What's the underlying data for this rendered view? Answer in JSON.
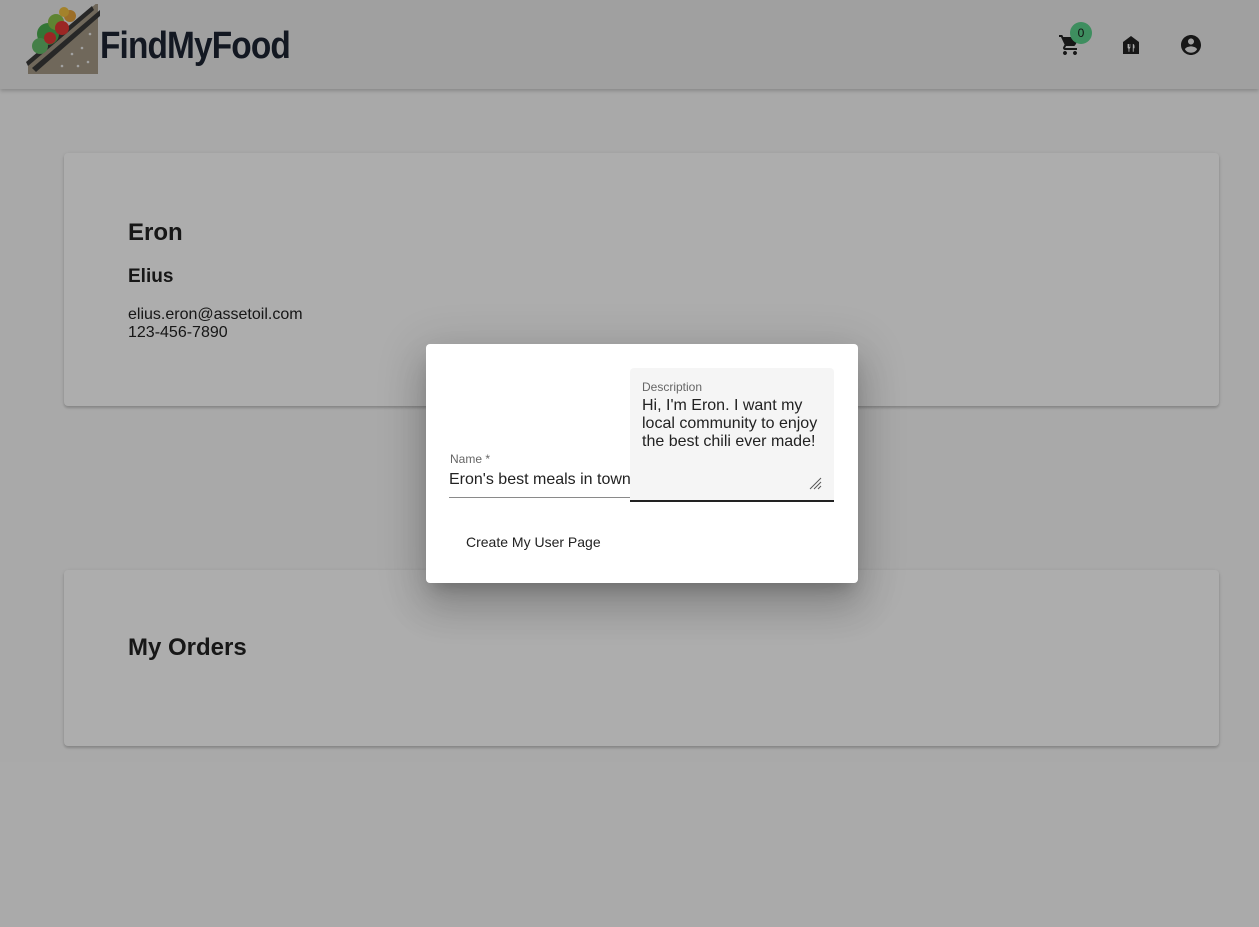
{
  "header": {
    "logo_text": "FindMyFood",
    "cart_count": "0",
    "icons": [
      "shopping-cart-icon",
      "restaurant-home-icon",
      "account-circle-icon"
    ],
    "badge_color": "#5cd18c"
  },
  "profile": {
    "first_name": "Eron",
    "last_name": "Elius",
    "email": "elius.eron@assetoil.com",
    "phone": "123-456-7890"
  },
  "orders": {
    "title": "My Orders"
  },
  "dialog": {
    "name_label": "Name *",
    "name_value": "Eron's best meals in town",
    "description_label": "Description",
    "description_value": "Hi, I'm Eron. I want my local community to enjoy the best chili ever made!",
    "create_button_label": "Create My User Page"
  }
}
